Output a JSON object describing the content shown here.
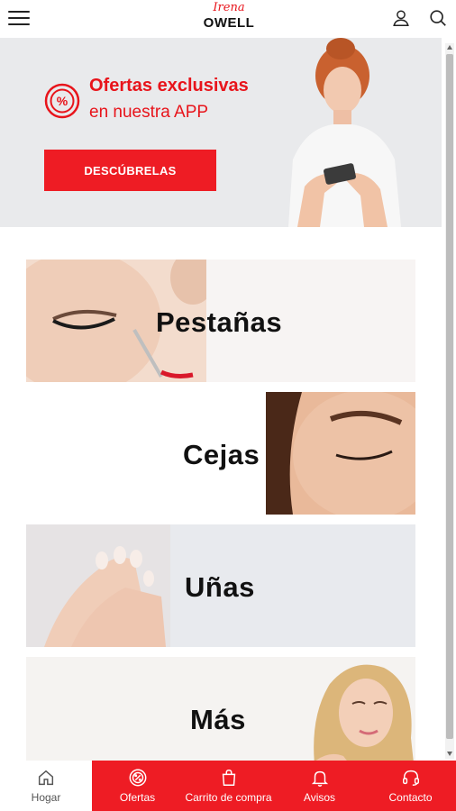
{
  "header": {
    "logo_script": "Irena",
    "logo_brand": "OWELL"
  },
  "banner": {
    "line1": "Ofertas exclusivas",
    "line2": "en nuestra APP",
    "cta_label": "DESCÚBRELAS",
    "badge_symbol": "%"
  },
  "categories": [
    {
      "label": "Pestañas"
    },
    {
      "label": "Cejas"
    },
    {
      "label": "Uñas"
    },
    {
      "label": "Más"
    }
  ],
  "bottom_nav": {
    "items": [
      {
        "label": "Hogar",
        "icon": "home-icon"
      },
      {
        "label": "Ofertas",
        "icon": "offers-icon"
      },
      {
        "label": "Carrito de compra",
        "icon": "shopping-bag-icon"
      },
      {
        "label": "Avisos",
        "icon": "bell-icon"
      },
      {
        "label": "Contacto",
        "icon": "headset-icon"
      }
    ]
  },
  "colors": {
    "accent": "#ee1c24",
    "banner_bg": "#e9eaec",
    "text": "#111111"
  }
}
